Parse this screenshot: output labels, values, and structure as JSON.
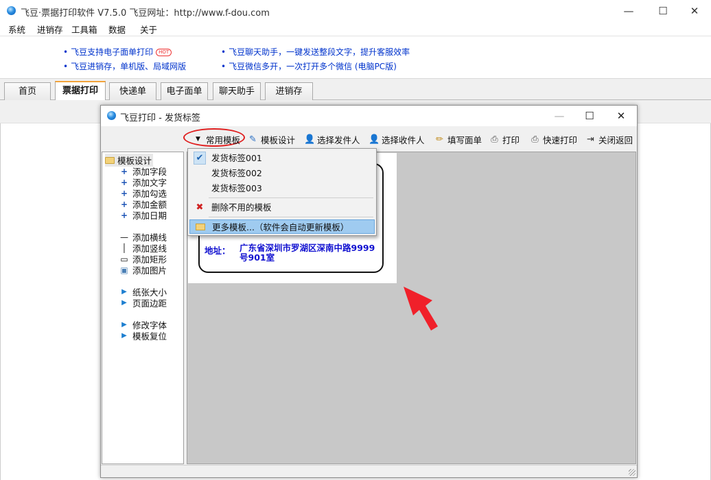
{
  "main_window": {
    "title": "飞豆·票据打印软件 V7.5.0   飞豆网址：http://www.f-dou.com",
    "controls": {
      "minimize": "—",
      "maximize": "☐",
      "close": "✕"
    }
  },
  "menu": [
    "系统",
    "进销存",
    "工具箱",
    "数据",
    "关于"
  ],
  "ads": {
    "left": [
      "飞豆支持电子面单打印",
      "飞豆进销存，单机版、局域网版"
    ],
    "hot_badge": "HOT",
    "right": [
      "飞豆聊天助手，一键发送整段文字，提升客服效率",
      "飞豆微信多开，一次打开多个微信 (电脑PC版)"
    ],
    "bullet": "•"
  },
  "tabs": [
    "首页",
    "票据打印",
    "快递单",
    "电子面单",
    "聊天助手",
    "进销存"
  ],
  "active_tab": "票据打印",
  "dialog": {
    "title": "飞豆打印 - 发货标签",
    "controls": {
      "minimize": "—",
      "maximize": "☐",
      "close": "✕"
    },
    "toolbar": {
      "templates": "常用模板",
      "design": "模板设计",
      "sender": "选择发件人",
      "receiver": "选择收件人",
      "fill": "填写面单",
      "print": "打印",
      "quick_print": "快速打印",
      "close_return": "关闭返回"
    },
    "tree": {
      "root": "模板设计",
      "add_items": [
        "添加字段",
        "添加文字",
        "添加勾选",
        "添加金额",
        "添加日期"
      ],
      "shape_items": [
        "添加横线",
        "添加竖线",
        "添加矩形",
        "添加图片"
      ],
      "page_items": [
        "纸张大小",
        "页面边距"
      ],
      "font_items": [
        "修改字体",
        "模板复位"
      ]
    },
    "label": {
      "address_label": "地址：",
      "address_value": "广东省深圳市罗湖区深南中路9999号901室"
    }
  },
  "dropdown": {
    "items": [
      "发货标签001",
      "发货标签002",
      "发货标签003"
    ],
    "checked_index": 0,
    "delete": "删除不用的模板",
    "more": "更多模板...（软件会自动更新模板）"
  },
  "colors": {
    "link_blue": "#0033cc",
    "address_blue": "#1010d0",
    "annotation_red": "#e02020",
    "tab_accent": "#f2a33a",
    "canvas_gray": "#c8c8c8",
    "highlight": "#9fcbf0"
  }
}
